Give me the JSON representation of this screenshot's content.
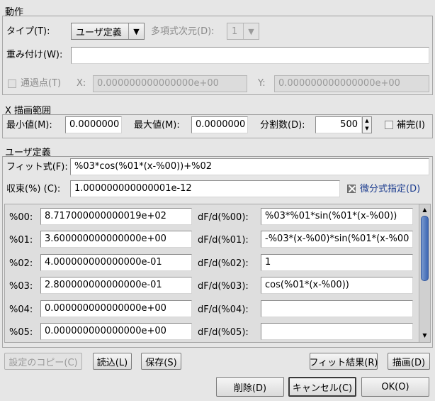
{
  "action": {
    "title": "動作",
    "type_label": "タイプ(T):",
    "type_value": "ユーザ定義",
    "poly_label": "多項式次元(D):",
    "poly_value": "1",
    "weight_label": "重み付け(W):",
    "weight_value": "",
    "through_label": "通過点(T)",
    "x_label": "X:",
    "x_value": "0.000000000000000e+00",
    "y_label": "Y:",
    "y_value": "0.000000000000000e+00"
  },
  "range": {
    "title": "X 描画範囲",
    "min_label": "最小値(M):",
    "min_value": "0.0000000",
    "max_label": "最大値(M):",
    "max_value": "0.0000000",
    "div_label": "分割数(D):",
    "div_value": "500",
    "interp_label": "補完(I)"
  },
  "user": {
    "title": "ユーザ定義",
    "formula_label": "フィット式(F):",
    "formula_value": "%03*cos(%01*(x-%00))+%02",
    "conv_label": "収束(%) (C):",
    "conv_value": "1.000000000000001e-12",
    "deriv_label": "微分式指定(D)",
    "params": [
      {
        "name": "%00:",
        "value": "8.717000000000019e+02",
        "dlabel": "dF/d(%00):",
        "dvalue": "%03*%01*sin(%01*(x-%00))"
      },
      {
        "name": "%01:",
        "value": "3.600000000000000e+00",
        "dlabel": "dF/d(%01):",
        "dvalue": "-%03*(x-%00)*sin(%01*(x-%00"
      },
      {
        "name": "%02:",
        "value": "4.000000000000000e-01",
        "dlabel": "dF/d(%02):",
        "dvalue": "1"
      },
      {
        "name": "%03:",
        "value": "2.800000000000000e-01",
        "dlabel": "dF/d(%03):",
        "dvalue": "cos(%01*(x-%00))"
      },
      {
        "name": "%04:",
        "value": "0.000000000000000e+00",
        "dlabel": "dF/d(%04):",
        "dvalue": ""
      },
      {
        "name": "%05:",
        "value": "0.000000000000000e+00",
        "dlabel": "dF/d(%05):",
        "dvalue": ""
      }
    ]
  },
  "buttons": {
    "copy": "設定のコピー(C)",
    "load": "読込(L)",
    "save": "保存(S)",
    "fit_result": "フィット結果(R)",
    "draw": "描画(D)",
    "delete": "削除(D)",
    "cancel": "キャンセル(C)",
    "ok": "OK(O)"
  },
  "icons": {
    "dropdown": "chevron-down-icon",
    "spin": "spin-arrows-icon",
    "check": "checkbox-icon"
  }
}
